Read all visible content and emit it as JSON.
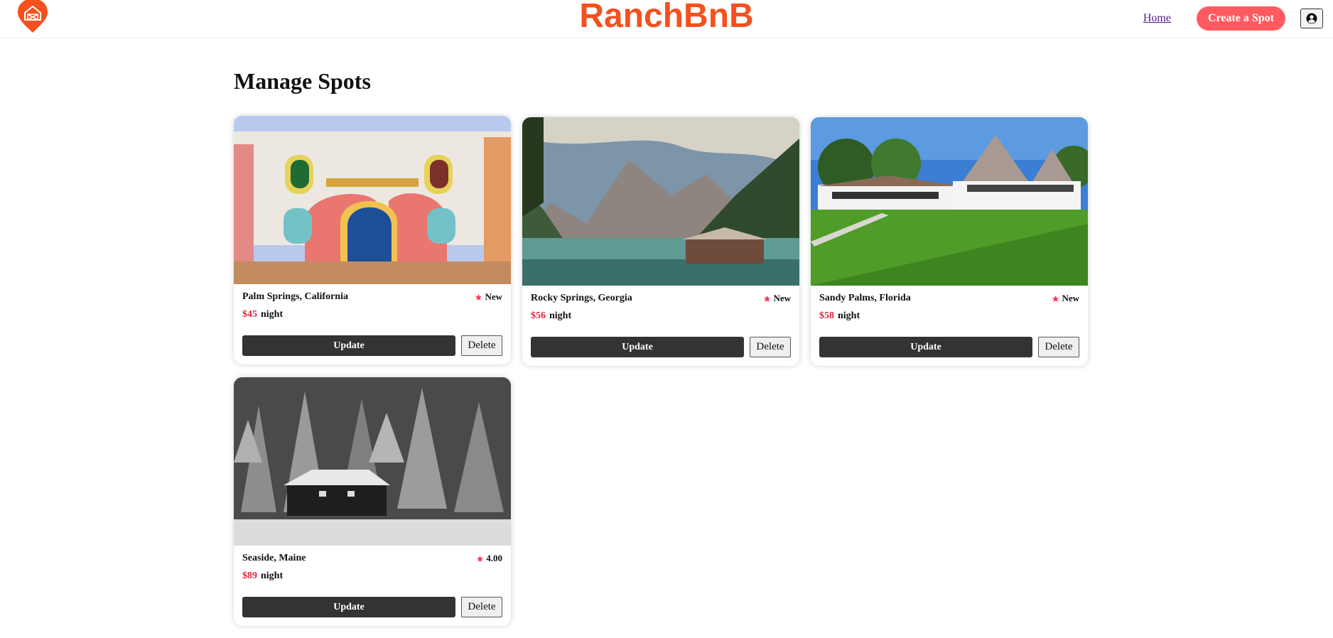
{
  "header": {
    "brand": "RanchBnB",
    "brand_color": "#f4511e",
    "logo_icon": "barn-pin-logo-icon",
    "nav": {
      "home_label": "Home",
      "create_label": "Create a Spot",
      "create_color": "#ff5a5f",
      "profile_icon": "user-circle-icon"
    }
  },
  "page": {
    "title": "Manage Spots"
  },
  "spots": [
    {
      "location": "Palm Springs, California",
      "rating": "New",
      "price": "$45",
      "unit": "night",
      "image": "painted-house-photo",
      "update_label": "Update",
      "delete_label": "Delete"
    },
    {
      "location": "Rocky Springs, Georgia",
      "rating": "New",
      "price": "$56",
      "unit": "night",
      "image": "mountain-lake-photo",
      "update_label": "Update",
      "delete_label": "Delete"
    },
    {
      "location": "Sandy Palms, Florida",
      "rating": "New",
      "price": "$58",
      "unit": "night",
      "image": "suburban-house-photo",
      "update_label": "Update",
      "delete_label": "Delete"
    },
    {
      "location": "Seaside, Maine",
      "rating": "4.00",
      "price": "$89",
      "unit": "night",
      "image": "snowy-cabin-photo",
      "update_label": "Update",
      "delete_label": "Delete"
    }
  ],
  "colors": {
    "star": "#ff385c",
    "price": "#e0243b",
    "update_button": "#333333"
  }
}
